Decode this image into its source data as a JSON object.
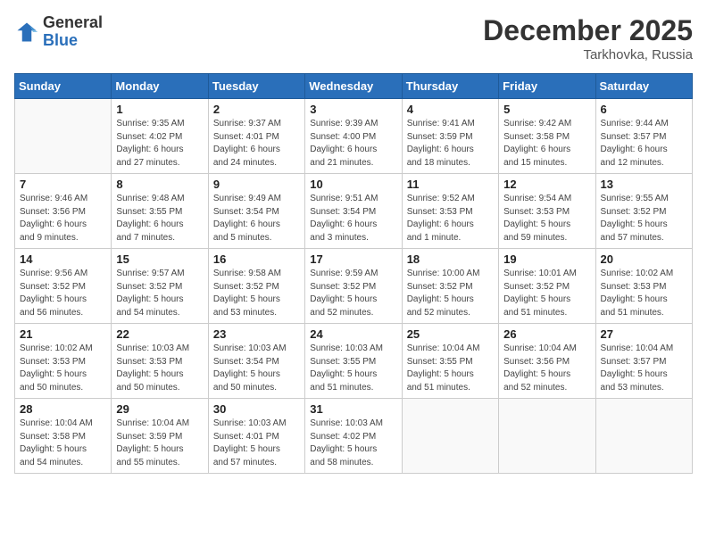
{
  "header": {
    "logo_general": "General",
    "logo_blue": "Blue",
    "month_year": "December 2025",
    "location": "Tarkhovka, Russia"
  },
  "weekdays": [
    "Sunday",
    "Monday",
    "Tuesday",
    "Wednesday",
    "Thursday",
    "Friday",
    "Saturday"
  ],
  "weeks": [
    [
      {
        "day": "",
        "info": ""
      },
      {
        "day": "1",
        "info": "Sunrise: 9:35 AM\nSunset: 4:02 PM\nDaylight: 6 hours\nand 27 minutes."
      },
      {
        "day": "2",
        "info": "Sunrise: 9:37 AM\nSunset: 4:01 PM\nDaylight: 6 hours\nand 24 minutes."
      },
      {
        "day": "3",
        "info": "Sunrise: 9:39 AM\nSunset: 4:00 PM\nDaylight: 6 hours\nand 21 minutes."
      },
      {
        "day": "4",
        "info": "Sunrise: 9:41 AM\nSunset: 3:59 PM\nDaylight: 6 hours\nand 18 minutes."
      },
      {
        "day": "5",
        "info": "Sunrise: 9:42 AM\nSunset: 3:58 PM\nDaylight: 6 hours\nand 15 minutes."
      },
      {
        "day": "6",
        "info": "Sunrise: 9:44 AM\nSunset: 3:57 PM\nDaylight: 6 hours\nand 12 minutes."
      }
    ],
    [
      {
        "day": "7",
        "info": "Sunrise: 9:46 AM\nSunset: 3:56 PM\nDaylight: 6 hours\nand 9 minutes."
      },
      {
        "day": "8",
        "info": "Sunrise: 9:48 AM\nSunset: 3:55 PM\nDaylight: 6 hours\nand 7 minutes."
      },
      {
        "day": "9",
        "info": "Sunrise: 9:49 AM\nSunset: 3:54 PM\nDaylight: 6 hours\nand 5 minutes."
      },
      {
        "day": "10",
        "info": "Sunrise: 9:51 AM\nSunset: 3:54 PM\nDaylight: 6 hours\nand 3 minutes."
      },
      {
        "day": "11",
        "info": "Sunrise: 9:52 AM\nSunset: 3:53 PM\nDaylight: 6 hours\nand 1 minute."
      },
      {
        "day": "12",
        "info": "Sunrise: 9:54 AM\nSunset: 3:53 PM\nDaylight: 5 hours\nand 59 minutes."
      },
      {
        "day": "13",
        "info": "Sunrise: 9:55 AM\nSunset: 3:52 PM\nDaylight: 5 hours\nand 57 minutes."
      }
    ],
    [
      {
        "day": "14",
        "info": "Sunrise: 9:56 AM\nSunset: 3:52 PM\nDaylight: 5 hours\nand 56 minutes."
      },
      {
        "day": "15",
        "info": "Sunrise: 9:57 AM\nSunset: 3:52 PM\nDaylight: 5 hours\nand 54 minutes."
      },
      {
        "day": "16",
        "info": "Sunrise: 9:58 AM\nSunset: 3:52 PM\nDaylight: 5 hours\nand 53 minutes."
      },
      {
        "day": "17",
        "info": "Sunrise: 9:59 AM\nSunset: 3:52 PM\nDaylight: 5 hours\nand 52 minutes."
      },
      {
        "day": "18",
        "info": "Sunrise: 10:00 AM\nSunset: 3:52 PM\nDaylight: 5 hours\nand 52 minutes."
      },
      {
        "day": "19",
        "info": "Sunrise: 10:01 AM\nSunset: 3:52 PM\nDaylight: 5 hours\nand 51 minutes."
      },
      {
        "day": "20",
        "info": "Sunrise: 10:02 AM\nSunset: 3:53 PM\nDaylight: 5 hours\nand 51 minutes."
      }
    ],
    [
      {
        "day": "21",
        "info": "Sunrise: 10:02 AM\nSunset: 3:53 PM\nDaylight: 5 hours\nand 50 minutes."
      },
      {
        "day": "22",
        "info": "Sunrise: 10:03 AM\nSunset: 3:53 PM\nDaylight: 5 hours\nand 50 minutes."
      },
      {
        "day": "23",
        "info": "Sunrise: 10:03 AM\nSunset: 3:54 PM\nDaylight: 5 hours\nand 50 minutes."
      },
      {
        "day": "24",
        "info": "Sunrise: 10:03 AM\nSunset: 3:55 PM\nDaylight: 5 hours\nand 51 minutes."
      },
      {
        "day": "25",
        "info": "Sunrise: 10:04 AM\nSunset: 3:55 PM\nDaylight: 5 hours\nand 51 minutes."
      },
      {
        "day": "26",
        "info": "Sunrise: 10:04 AM\nSunset: 3:56 PM\nDaylight: 5 hours\nand 52 minutes."
      },
      {
        "day": "27",
        "info": "Sunrise: 10:04 AM\nSunset: 3:57 PM\nDaylight: 5 hours\nand 53 minutes."
      }
    ],
    [
      {
        "day": "28",
        "info": "Sunrise: 10:04 AM\nSunset: 3:58 PM\nDaylight: 5 hours\nand 54 minutes."
      },
      {
        "day": "29",
        "info": "Sunrise: 10:04 AM\nSunset: 3:59 PM\nDaylight: 5 hours\nand 55 minutes."
      },
      {
        "day": "30",
        "info": "Sunrise: 10:03 AM\nSunset: 4:01 PM\nDaylight: 5 hours\nand 57 minutes."
      },
      {
        "day": "31",
        "info": "Sunrise: 10:03 AM\nSunset: 4:02 PM\nDaylight: 5 hours\nand 58 minutes."
      },
      {
        "day": "",
        "info": ""
      },
      {
        "day": "",
        "info": ""
      },
      {
        "day": "",
        "info": ""
      }
    ]
  ]
}
